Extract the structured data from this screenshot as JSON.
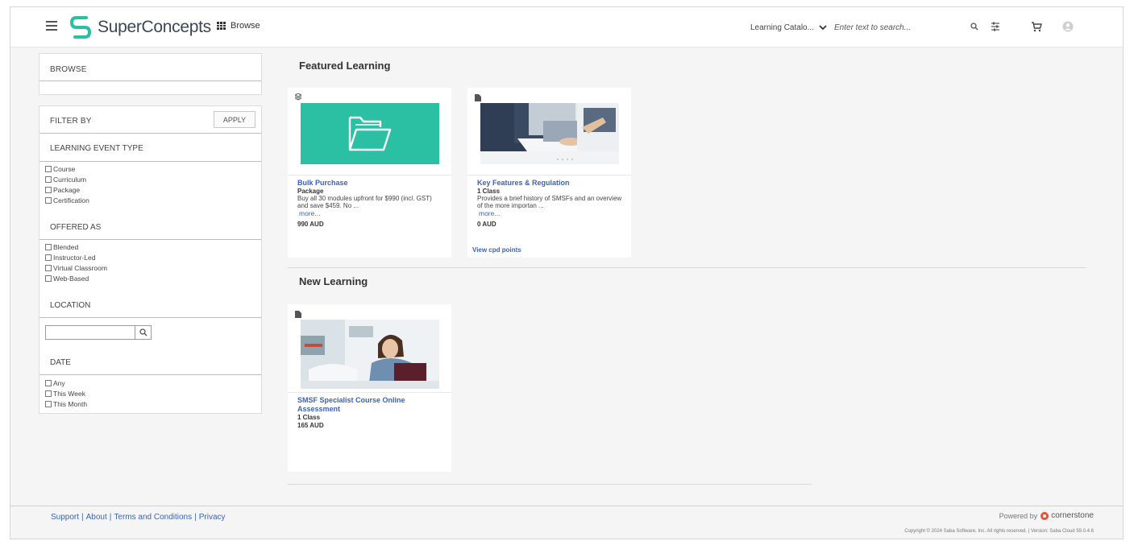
{
  "header": {
    "logo_text": "SuperConcepts",
    "browse_label": "Browse",
    "catalog_label": "Learning Catalo...",
    "search_placeholder": "Enter text to search...",
    "icons": [
      "menu-icon",
      "grid-icon",
      "chevron-down-icon",
      "search-icon",
      "filter-icon",
      "cart-icon",
      "user-avatar-icon"
    ]
  },
  "sidebar": {
    "browse_title": "BROWSE",
    "filter_title": "FILTER BY",
    "apply_label": "APPLY",
    "learning_event_type": {
      "title": "LEARNING EVENT TYPE",
      "options": [
        "Course",
        "Curriculum",
        "Package",
        "Certification"
      ]
    },
    "offered_as": {
      "title": "OFFERED AS",
      "options": [
        "Blended",
        "Instructor-Led",
        "Virtual Classroom",
        "Web-Based"
      ]
    },
    "location": {
      "title": "LOCATION",
      "value": ""
    },
    "date": {
      "title": "DATE",
      "options": [
        "Any",
        "This Week",
        "This Month"
      ]
    }
  },
  "main": {
    "featured_title": "Featured Learning",
    "new_title": "New Learning",
    "featured_cards": [
      {
        "title": "Bulk Purchase",
        "subtitle": "Package",
        "description": "Buy all 30 modules upfront for $990 (incl. GST) and save $459. No ...",
        "more": "more...",
        "price": "990 AUD"
      },
      {
        "title": "Key Features & Regulation",
        "subtitle": "1 Class",
        "description": "Provides a brief history of SMSFs and an overview of the more importan ...",
        "more": "more...",
        "price": "0 AUD",
        "extra_link": "View cpd points"
      }
    ],
    "new_cards": [
      {
        "title": "SMSF Specialist Course Online Assessment",
        "subtitle": "1 Class",
        "price": "165 AUD"
      }
    ]
  },
  "footer": {
    "links": [
      "Support",
      "About",
      "Terms and Conditions",
      "Privacy"
    ],
    "separator": "|",
    "powered_by": "Powered by",
    "brand": "cornerstone",
    "copyright": "Copyright © 2024 Saba Software, Inc. All rights reserved.  |  Version: Saba Cloud 59.0.4.6"
  },
  "colors": {
    "brand_teal": "#2bbfa4",
    "link_blue": "#3b64b7",
    "background": "#f5f5f5"
  }
}
